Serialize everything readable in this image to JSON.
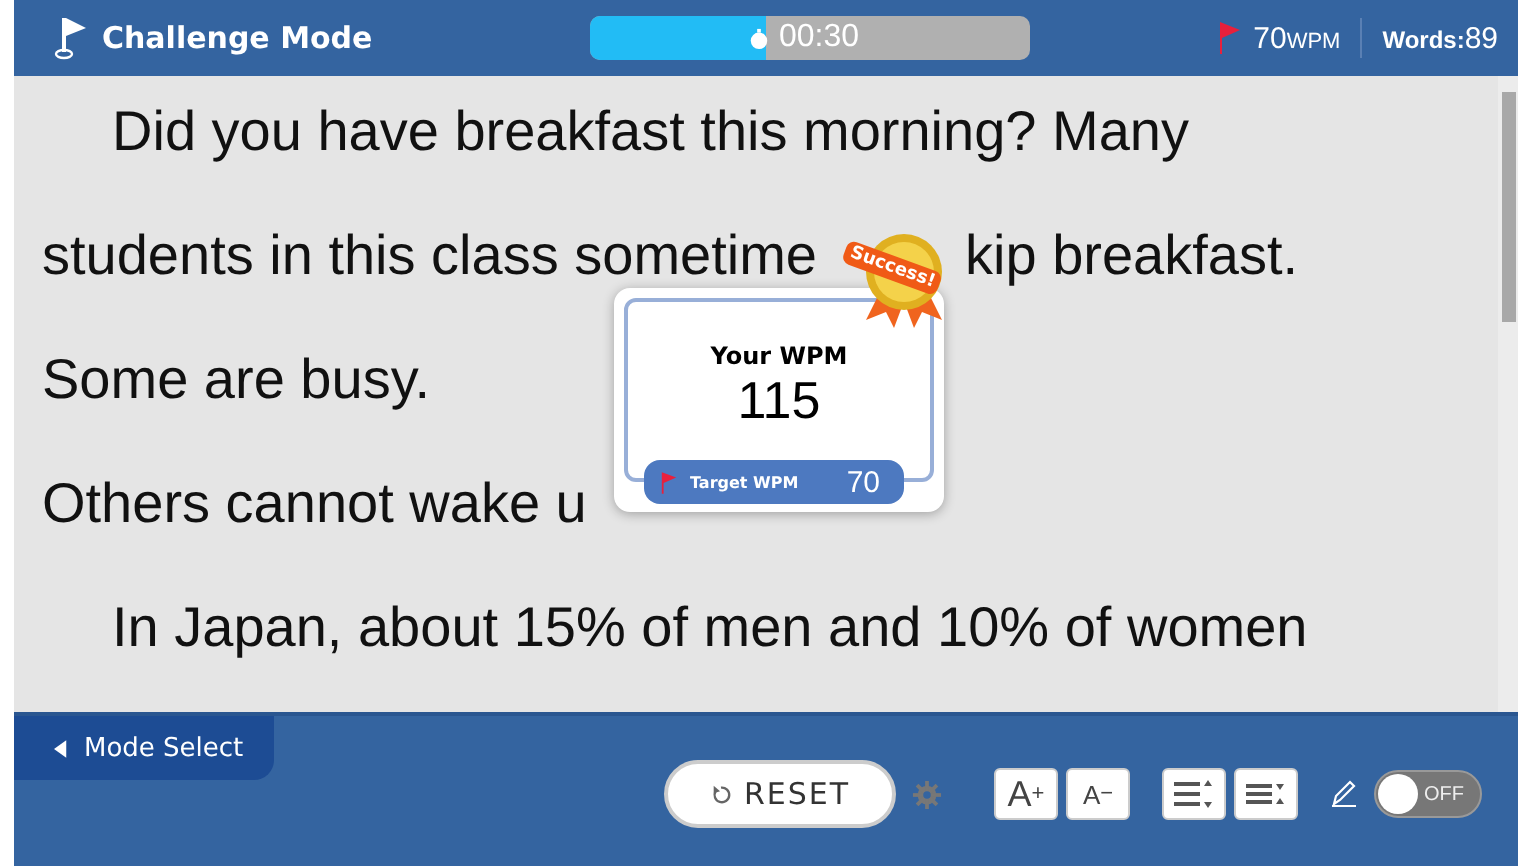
{
  "header": {
    "title": "Challenge Mode",
    "timer": {
      "text": "00:30",
      "level": 0.4
    },
    "target": {
      "value": "70",
      "unit": "WPM"
    },
    "words": {
      "label": "Words:",
      "value": "89"
    }
  },
  "passage": [
    {
      "indent": true,
      "segments": [
        "Did you have breakfast this morning? Many"
      ]
    },
    {
      "indent": false,
      "segments": [
        "students in this class sometime",
        "kip breakfast."
      ]
    },
    {
      "indent": false,
      "segments": [
        "Some are busy."
      ]
    },
    {
      "indent": false,
      "segments": [
        "Others cannot wake u"
      ]
    },
    {
      "indent": true,
      "segments": [
        "In Japan, about 15% of men and 10% of women"
      ]
    }
  ],
  "result": {
    "badge": "Success!",
    "label": "Your WPM",
    "value": "115",
    "target_label": "Target WPM",
    "target_value": "70"
  },
  "footer": {
    "mode_select": "Mode Select",
    "reset": "RESET",
    "font_up": {
      "letter": "A",
      "sign": "+"
    },
    "font_down": {
      "letter": "A",
      "sign": "−"
    },
    "pen_toggle": {
      "on": false,
      "label": "OFF"
    }
  }
}
